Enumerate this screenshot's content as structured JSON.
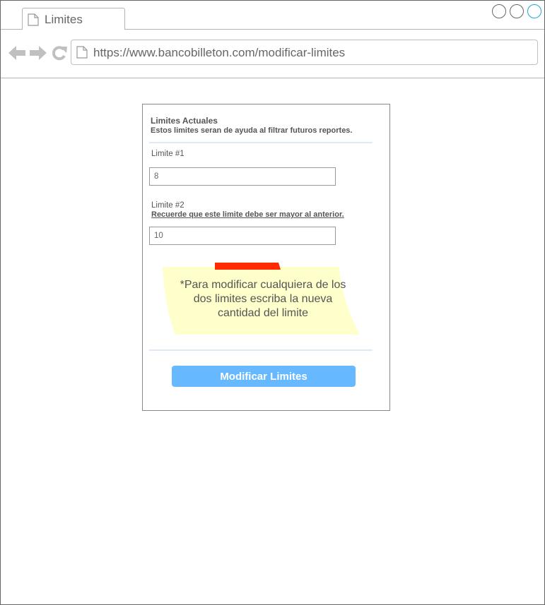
{
  "browser": {
    "tab_title": "Limites",
    "url": "https://www.bancobilleton.com/modificar-limites"
  },
  "form": {
    "title": "Limites Actuales",
    "subtitle": "Estos limites seran de ayuda al filtrar futuros reportes.",
    "limit1": {
      "label": "Limite #1",
      "value": "8"
    },
    "limit2": {
      "label": "Limite #2",
      "note": "Recuerde que este limite debe ser mayor al anterior.",
      "value": "10"
    },
    "sticky_note": "*Para modificar cualquiera de los dos limites escriba la nueva cantidad del limite",
    "submit_label": "Modificar Limites"
  },
  "colors": {
    "button": "#66b9ff",
    "sticky": "#ffffcc",
    "tape": "#ff2a00",
    "divider": "#deebf7"
  }
}
